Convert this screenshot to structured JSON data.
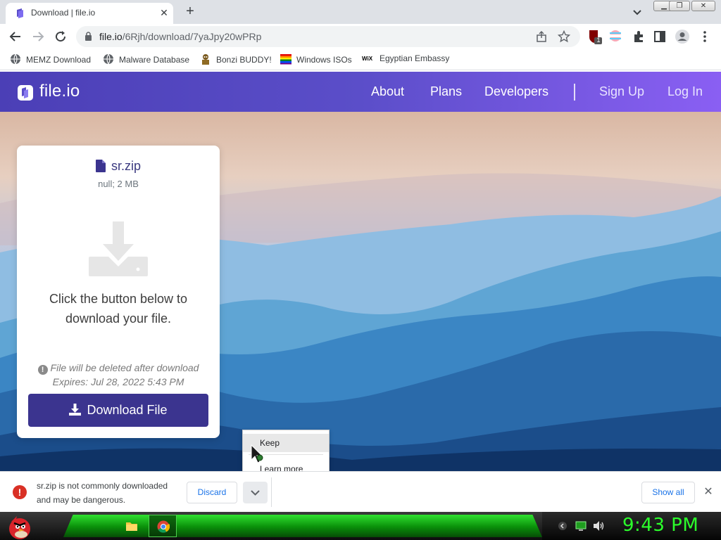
{
  "browser": {
    "tab": {
      "title": "Download | file.io",
      "close_icon": "close-icon",
      "favicon": "fileio-favicon-icon"
    },
    "new_tab_icon": "plus-icon",
    "tab_search_icon": "chevron-down-icon",
    "window_buttons": [
      "minimize",
      "restore",
      "close"
    ],
    "address": {
      "domain": "file.io",
      "path": "/6Rjh/download/7yaJpy20wPRp"
    },
    "extension_badge": "1"
  },
  "bookmarks": [
    {
      "label": "MEMZ Download",
      "icon": "globe-icon"
    },
    {
      "label": "Malware Database",
      "icon": "globe-icon"
    },
    {
      "label": "Bonzi BUDDY!",
      "icon": "bonzi-icon"
    },
    {
      "label": "Windows ISOs",
      "icon": "windows-flag-icon"
    },
    {
      "label": "Egyptian Embassy",
      "icon": "wix-icon"
    }
  ],
  "site": {
    "logo": "file.io",
    "nav": {
      "about": "About",
      "plans": "Plans",
      "developers": "Developers",
      "signup": "Sign Up",
      "login": "Log In"
    },
    "card": {
      "filename": "sr.zip",
      "meta": "null; 2 MB",
      "cta_line1": "Click the button below to",
      "cta_line2": "download your file.",
      "warn_line1": "File will be deleted after download",
      "warn_line2": "Expires: Jul 28, 2022 5:43 PM",
      "download_button": "Download File"
    },
    "colors": {
      "header_start": "#4b3fb6",
      "header_end": "#8a5ff3",
      "button": "#3b348f"
    }
  },
  "context_menu": {
    "keep": "Keep",
    "learn_more": "Learn more"
  },
  "download_bar": {
    "message_line1": "sr.zip is not commonly downloaded",
    "message_line2": "and may be dangerous.",
    "discard": "Discard",
    "show_all": "Show all"
  },
  "taskbar": {
    "clock": "9:43 PM"
  }
}
